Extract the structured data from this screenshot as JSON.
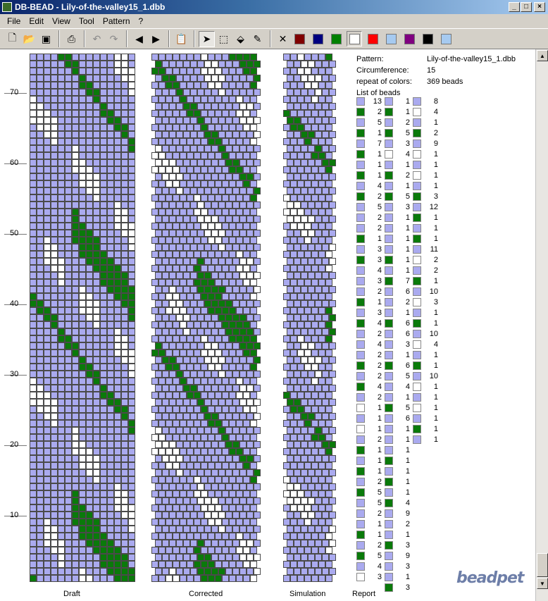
{
  "window": {
    "title": "DB-BEAD - Lily-of-the-valley15_1.dbb",
    "minimize": "_",
    "maximize": "□",
    "close": "×"
  },
  "menu": [
    "File",
    "Edit",
    "View",
    "Tool",
    "Pattern",
    "?"
  ],
  "toolbar": {
    "tools": [
      "new-icon",
      "open-icon",
      "save-icon",
      "print-icon",
      "undo-icon",
      "redo-icon",
      "arrow-left-icon",
      "arrow-right-icon",
      "paste-icon",
      "pointer-icon",
      "select-icon",
      "fill-icon",
      "pipette-icon"
    ],
    "colors": [
      "#ffffff",
      "#800000",
      "#000080",
      "#008000",
      "#ffffff",
      "#ff0000",
      "#a6caf0",
      "#800080",
      "#000000",
      "#a6caf0"
    ]
  },
  "colors": {
    "lavender": "#aaaaef",
    "green": "#0a7a0a",
    "white": "#ffffff"
  },
  "ruler": [
    "70",
    "60",
    "50",
    "40",
    "30",
    "20",
    "10"
  ],
  "captions": {
    "draft": "Draft",
    "corrected": "Corrected",
    "simulation": "Simulation",
    "report": "Report"
  },
  "report": {
    "pattern_label": "Pattern:",
    "pattern_value": "Lily-of-the-valley15_1.dbb",
    "circ_label": "Circumference:",
    "circ_value": "15",
    "repeat_label": "repeat of colors:",
    "repeat_value": "369 beads",
    "list_label": "List of beads"
  },
  "beads": {
    "col1": [
      [
        "l",
        "13"
      ],
      [
        "g",
        "2"
      ],
      [
        "l",
        "5"
      ],
      [
        "g",
        "1"
      ],
      [
        "l",
        "7"
      ],
      [
        "g",
        "1"
      ],
      [
        "l",
        "1"
      ],
      [
        "g",
        "1"
      ],
      [
        "l",
        "4"
      ],
      [
        "g",
        "2"
      ],
      [
        "l",
        "5"
      ],
      [
        "l",
        "2"
      ],
      [
        "l",
        "2"
      ],
      [
        "g",
        "1"
      ],
      [
        "l",
        "3"
      ],
      [
        "g",
        "3"
      ],
      [
        "l",
        "4"
      ],
      [
        "l",
        "3"
      ],
      [
        "l",
        "2"
      ],
      [
        "g",
        "1"
      ],
      [
        "l",
        "3"
      ],
      [
        "g",
        "4"
      ],
      [
        "l",
        "2"
      ],
      [
        "l",
        "4"
      ],
      [
        "l",
        "2"
      ],
      [
        "g",
        "2"
      ],
      [
        "l",
        "2"
      ],
      [
        "g",
        "4"
      ],
      [
        "l",
        "2"
      ],
      [
        "w",
        "1"
      ],
      [
        "l",
        "1"
      ],
      [
        "w",
        "1"
      ],
      [
        "l",
        "2"
      ],
      [
        "g",
        "1"
      ],
      [
        "l",
        "1"
      ],
      [
        "g",
        "1"
      ],
      [
        "l",
        "2"
      ],
      [
        "g",
        "5"
      ],
      [
        "l",
        "5"
      ],
      [
        "l",
        "2"
      ],
      [
        "l",
        "1"
      ],
      [
        "g",
        "1"
      ],
      [
        "l",
        "2"
      ],
      [
        "g",
        "5"
      ],
      [
        "l",
        "4"
      ],
      [
        "w",
        "3"
      ]
    ],
    "col2": [
      [
        "l",
        "1"
      ],
      [
        "g",
        "1"
      ],
      [
        "l",
        "2"
      ],
      [
        "g",
        "5"
      ],
      [
        "l",
        "3"
      ],
      [
        "w",
        "4"
      ],
      [
        "l",
        "1"
      ],
      [
        "g",
        "2"
      ],
      [
        "l",
        "1"
      ],
      [
        "g",
        "5"
      ],
      [
        "l",
        "3"
      ],
      [
        "l",
        "1"
      ],
      [
        "l",
        "1"
      ],
      [
        "l",
        "1"
      ],
      [
        "l",
        "1"
      ],
      [
        "g",
        "1"
      ],
      [
        "l",
        "1"
      ],
      [
        "g",
        "7"
      ],
      [
        "l",
        "6"
      ],
      [
        "l",
        "2"
      ],
      [
        "l",
        "1"
      ],
      [
        "g",
        "6"
      ],
      [
        "l",
        "6"
      ],
      [
        "l",
        "3"
      ],
      [
        "l",
        "1"
      ],
      [
        "g",
        "6"
      ],
      [
        "l",
        "5"
      ],
      [
        "l",
        "4"
      ],
      [
        "l",
        "1"
      ],
      [
        "g",
        "5"
      ],
      [
        "l",
        "6"
      ],
      [
        "l",
        "1"
      ],
      [
        "l",
        "1"
      ],
      [
        "l",
        "1"
      ],
      [
        "g",
        "1"
      ],
      [
        "l",
        "1"
      ],
      [
        "g",
        "1"
      ],
      [
        "l",
        "1"
      ],
      [
        "g",
        "4"
      ],
      [
        "l",
        "9"
      ],
      [
        "l",
        "2"
      ],
      [
        "l",
        "1"
      ],
      [
        "g",
        "3"
      ],
      [
        "l",
        "9"
      ],
      [
        "l",
        "3"
      ],
      [
        "l",
        "1"
      ],
      [
        "g",
        "3"
      ]
    ],
    "col3": [
      [
        "l",
        "8"
      ],
      [
        "w",
        "4"
      ],
      [
        "l",
        "1"
      ],
      [
        "g",
        "2"
      ],
      [
        "l",
        "9"
      ],
      [
        "w",
        "1"
      ],
      [
        "l",
        "1"
      ],
      [
        "w",
        "1"
      ],
      [
        "l",
        "1"
      ],
      [
        "g",
        "3"
      ],
      [
        "l",
        "12"
      ],
      [
        "g",
        "1"
      ],
      [
        "l",
        "1"
      ],
      [
        "g",
        "1"
      ],
      [
        "l",
        "11"
      ],
      [
        "w",
        "2"
      ],
      [
        "l",
        "2"
      ],
      [
        "g",
        "1"
      ],
      [
        "l",
        "10"
      ],
      [
        "w",
        "3"
      ],
      [
        "l",
        "1"
      ],
      [
        "g",
        "1"
      ],
      [
        "l",
        "10"
      ],
      [
        "w",
        "4"
      ],
      [
        "l",
        "1"
      ],
      [
        "g",
        "1"
      ],
      [
        "l",
        "10"
      ],
      [
        "w",
        "1"
      ],
      [
        "l",
        "1"
      ],
      [
        "w",
        "1"
      ],
      [
        "l",
        "1"
      ],
      [
        "g",
        "1"
      ],
      [
        "l",
        "1"
      ]
    ]
  }
}
